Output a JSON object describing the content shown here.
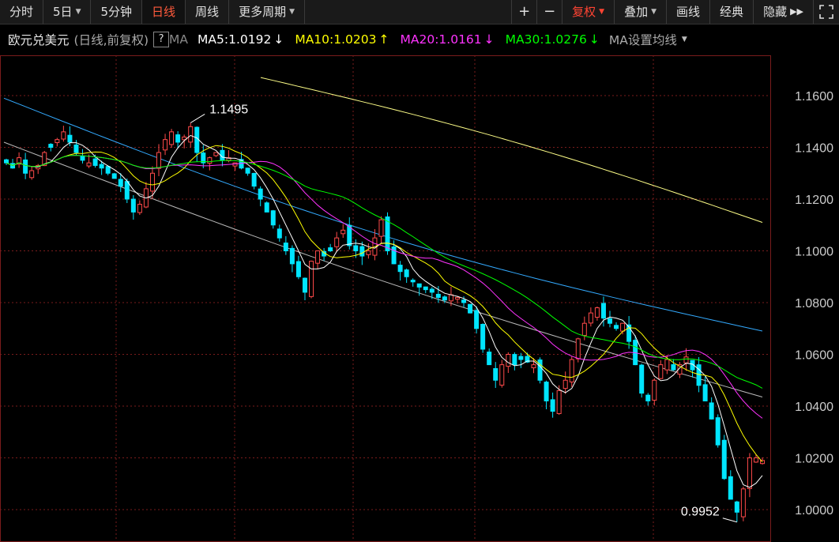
{
  "toolbar": {
    "tabs": [
      "分时",
      "5日",
      "5分钟",
      "日线",
      "周线",
      "更多周期"
    ],
    "zoom_in": "+",
    "zoom_out": "−",
    "fuquan": "复权",
    "overlay": "叠加",
    "draw": "画线",
    "classic": "经典",
    "hide": "隐藏"
  },
  "info": {
    "name": "欧元兑美元",
    "mode": "(日线,前复权)",
    "help": "?",
    "ma_label": "MA",
    "ma5": "MA5:1.0192",
    "ma10": "MA10:1.0203",
    "ma20": "MA20:1.0161",
    "ma30": "MA30:1.0276",
    "ma_settings": "MA设置均线",
    "arrow_down": "↓",
    "arrow_up": "↑"
  },
  "colors": {
    "up": "#ff4a4a",
    "down": "#00e5ff",
    "ma5": "#ffffff",
    "ma10": "#ffff00",
    "ma20": "#ff33ff",
    "ma30": "#00ff00",
    "ma60": "#bbbbbb",
    "ma120": "#33aaff",
    "ma250": "#ffff88",
    "grid": "#7a1c1c"
  },
  "chart_data": {
    "type": "candlestick",
    "ylim": [
      0.99,
      1.175
    ],
    "yticks": [
      "1.1600",
      "1.1400",
      "1.1200",
      "1.1000",
      "1.0800",
      "1.0600",
      "1.0400",
      "1.0200",
      "1.0000"
    ],
    "annotations": {
      "high": "1.1495",
      "low": "0.9952"
    },
    "n_candles": 120,
    "closes": [
      1.134,
      1.132,
      1.136,
      1.13,
      1.131,
      1.133,
      1.138,
      1.14,
      1.143,
      1.146,
      1.142,
      1.138,
      1.135,
      1.134,
      1.133,
      1.132,
      1.13,
      1.128,
      1.125,
      1.12,
      1.115,
      1.118,
      1.124,
      1.13,
      1.138,
      1.143,
      1.146,
      1.142,
      1.144,
      1.148,
      1.138,
      1.134,
      1.136,
      1.138,
      1.135,
      1.136,
      1.134,
      1.132,
      1.13,
      1.125,
      1.12,
      1.115,
      1.11,
      1.105,
      1.1,
      1.095,
      1.09,
      1.084,
      1.096,
      1.1,
      1.098,
      1.1,
      1.105,
      1.108,
      1.102,
      1.1,
      1.098,
      1.1,
      1.105,
      1.112,
      1.1,
      1.095,
      1.092,
      1.09,
      1.088,
      1.086,
      1.085,
      1.084,
      1.082,
      1.081,
      1.083,
      1.082,
      1.08,
      1.076,
      1.07,
      1.062,
      1.056,
      1.05,
      1.056,
      1.06,
      1.056,
      1.058,
      1.057,
      1.056,
      1.05,
      1.042,
      1.038,
      1.046,
      1.05,
      1.058,
      1.066,
      1.072,
      1.076,
      1.078,
      1.074,
      1.072,
      1.07,
      1.072,
      1.065,
      1.056,
      1.045,
      1.042,
      1.05,
      1.056,
      1.058,
      1.054,
      1.056,
      1.059,
      1.054,
      1.048,
      1.042,
      1.035,
      1.025,
      1.012,
      1.004,
      0.999,
      1.008,
      1.02,
      1.02,
      1.019
    ],
    "ma250_range": [
      1.167,
      1.111
    ],
    "ma120_range": [
      1.159,
      1.069
    ],
    "ma60_range": [
      1.142,
      1.0435
    ]
  }
}
